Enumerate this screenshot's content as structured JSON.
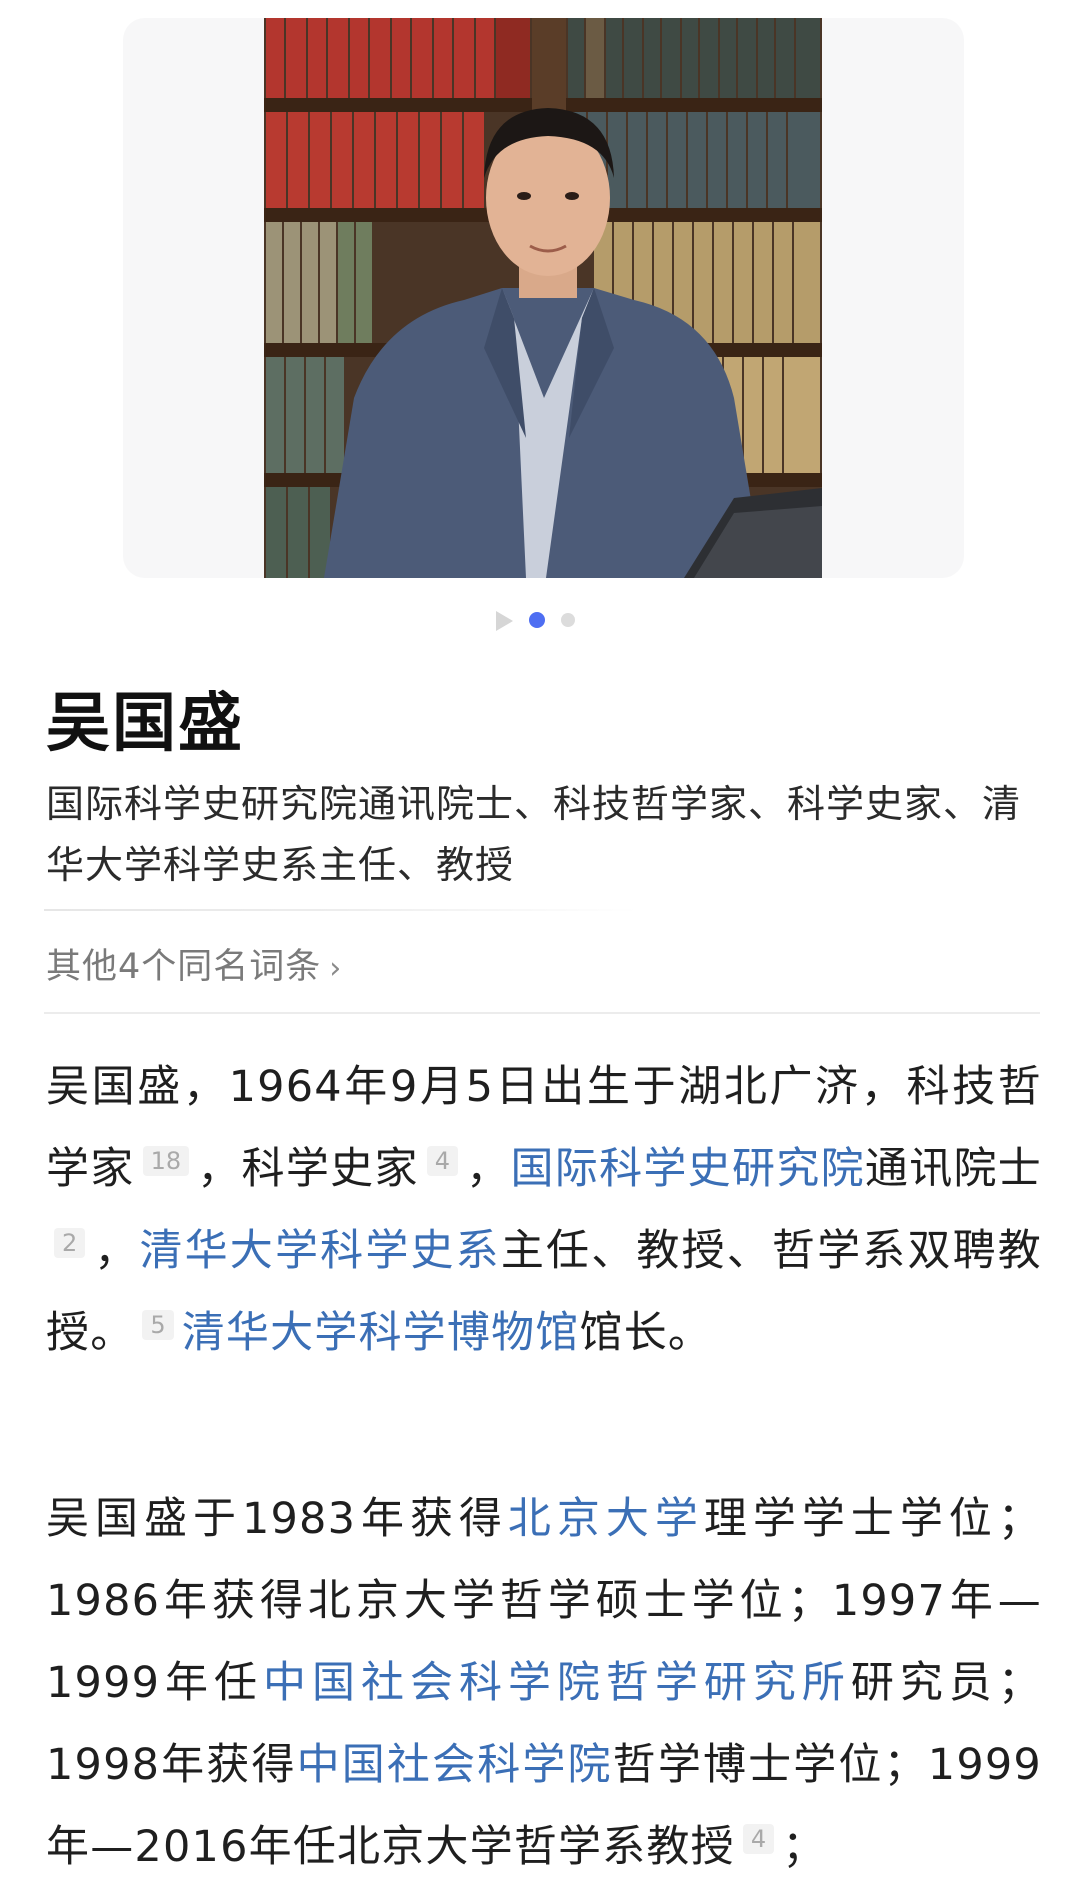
{
  "carousel": {
    "total_slides": 3,
    "active_index": 1,
    "first_is_video": true
  },
  "entry": {
    "title": "吴国盛",
    "subtitle": "国际科学史研究院通讯院士、科技哲学家、科学史家、清华大学科学史系主任、教授",
    "same_name_link": "其他4个同名词条"
  },
  "paragraph1": {
    "t1": "吴国盛，1964年9月5日出生于湖北广济，科技哲学家",
    "r1": "18",
    "t2": "，科学史家",
    "r2": "4",
    "t3": "，",
    "l1": "国际科学史研究院",
    "t4": "通讯院士",
    "r3": "2",
    "t5": "，",
    "l2": "清华大学科学史系",
    "t6": "主任、教授、哲学系双聘教授。",
    "r4": "5",
    "l3": "清华大学科学博物馆",
    "t7": "馆长。"
  },
  "paragraph2": {
    "t1": "吴国盛于1983年获得",
    "l1": "北京大学",
    "t2": "理学学士学位；1986年获得北京大学哲学硕士学位；1997年—1999年任",
    "l2": "中国社会科学院哲学研究所",
    "t3": "研究员；1998年获得",
    "l3": "中国社会科学院",
    "t4": "哲学博士学位；1999年—2016年任北京大学哲学系教授",
    "r1": "4",
    "t5": "；"
  },
  "colors": {
    "link": "#3b6fb6",
    "carousel_active": "#4e6ef2",
    "reference_badge_bg": "#f2f2f2"
  },
  "image": {
    "alt": "portrait-photo-man-in-library"
  }
}
